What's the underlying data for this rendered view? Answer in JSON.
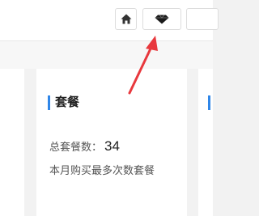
{
  "header": {
    "buttons": [
      {
        "icon": "home-icon"
      },
      {
        "icon": "diamond-icon"
      }
    ]
  },
  "card": {
    "title": "套餐",
    "total_label": "总套餐数：",
    "total_value": "34",
    "description": "本月购买最多次数套餐"
  },
  "colors": {
    "accent": "#2f86e8",
    "annotation_arrow": "#e8383d"
  }
}
